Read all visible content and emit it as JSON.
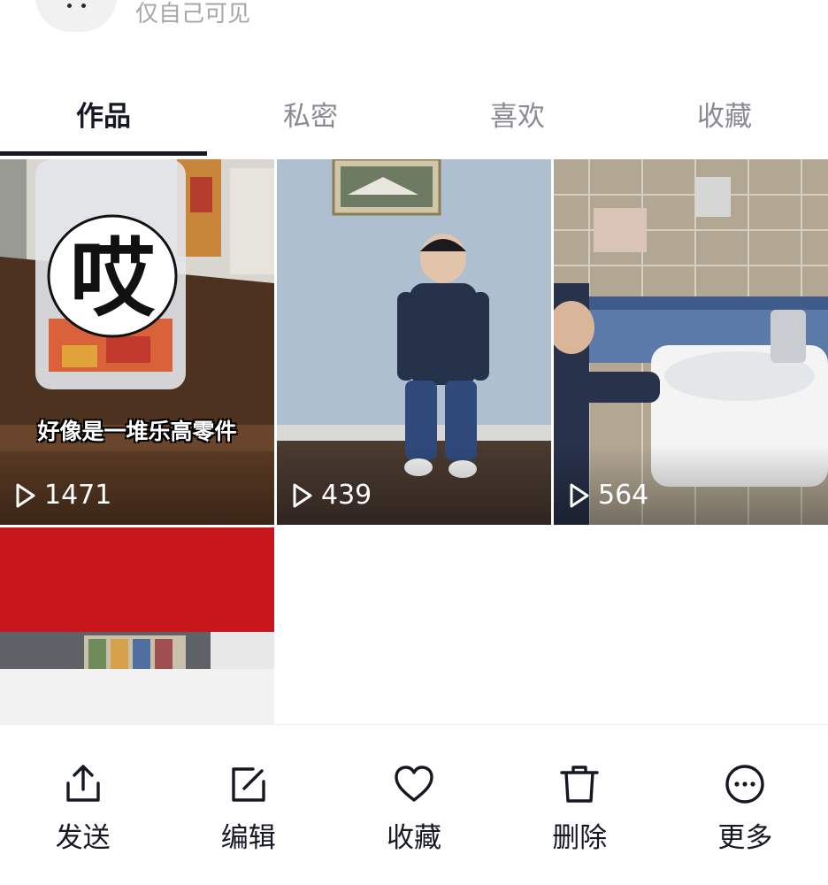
{
  "header": {
    "visibility_text": "仅自己可见"
  },
  "tabs": [
    {
      "label": "作品",
      "active": true
    },
    {
      "label": "私密",
      "active": false
    },
    {
      "label": "喜欢",
      "active": false
    },
    {
      "label": "收藏",
      "active": false
    }
  ],
  "videos": [
    {
      "plays": "1471",
      "sticker_text": "哎",
      "caption": "好像是一堆乐高零件"
    },
    {
      "plays": "439"
    },
    {
      "plays": "564"
    },
    {
      "plays": ""
    }
  ],
  "actions": [
    {
      "label": "发送",
      "icon": "share-icon"
    },
    {
      "label": "编辑",
      "icon": "edit-icon"
    },
    {
      "label": "收藏",
      "icon": "heart-icon"
    },
    {
      "label": "删除",
      "icon": "trash-icon"
    },
    {
      "label": "更多",
      "icon": "more-icon"
    }
  ],
  "colors": {
    "text_primary": "#161823",
    "text_secondary": "#8a8b91",
    "muted": "#a6a7ab"
  }
}
